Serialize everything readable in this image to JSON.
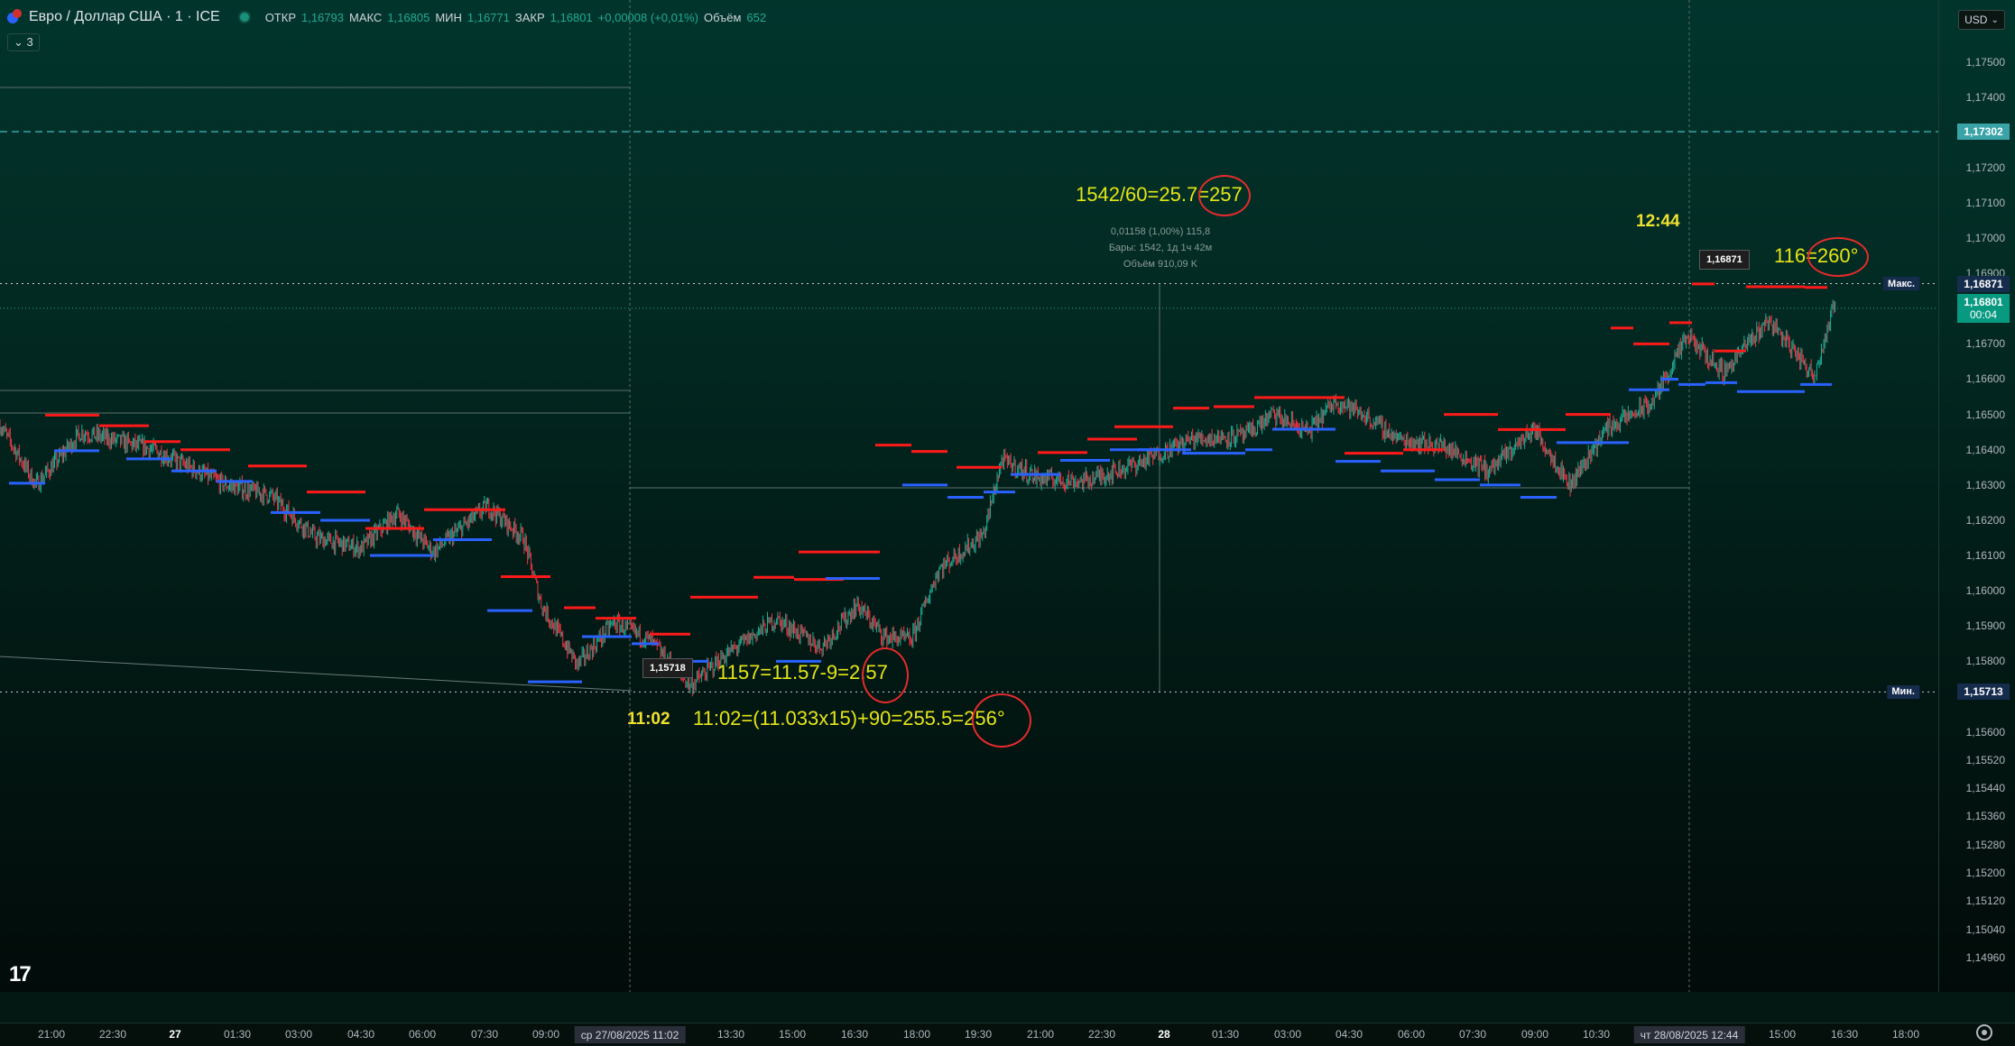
{
  "header": {
    "symbol_title": "Евро / Доллар США · 1 · ICE",
    "ohlc": [
      {
        "label": "ОТКР",
        "value": "1,16793"
      },
      {
        "label": "МАКС",
        "value": "1,16805"
      },
      {
        "label": "МИН",
        "value": "1,16771"
      },
      {
        "label": "ЗАКР",
        "value": "1,16801"
      }
    ],
    "change": "+0,00008 (+0,01%)",
    "volume_label": "Объём",
    "volume_value": "652",
    "indicators_count": "3",
    "currency_button": "USD"
  },
  "colors": {
    "up_candle": "#22ab94",
    "down_candle": "#f23645",
    "resistance_level": "#ff1a1a",
    "support_level": "#2962ff",
    "annotation_text": "#e5e517",
    "annotation_circle": "#e52b2b",
    "current_price": "#089981",
    "dashed_level": "#3aa3a8"
  },
  "price_axis": {
    "ticks": [
      "1,17500",
      "1,17400",
      "1,17200",
      "1,17100",
      "1,17000",
      "1,16900",
      "1,16700",
      "1,16600",
      "1,16500",
      "1,16400",
      "1,16300",
      "1,16200",
      "1,16100",
      "1,16000",
      "1,15900",
      "1,15800",
      "1,15600",
      "1,15520",
      "1,15440",
      "1,15360",
      "1,15280",
      "1,15200",
      "1,15120",
      "1,15040",
      "1,14960"
    ],
    "dashed_level_label": "1,17302",
    "max_tag": "Макс.",
    "max_value": "1,16871",
    "current_price": "1,16801",
    "countdown": "00:04",
    "min_tag": "Мин.",
    "min_value": "1,15713"
  },
  "time_axis": {
    "ticks": [
      {
        "label": "21:00",
        "bold": false
      },
      {
        "label": "22:30",
        "bold": false
      },
      {
        "label": "27",
        "bold": true
      },
      {
        "label": "01:30",
        "bold": false
      },
      {
        "label": "03:00",
        "bold": false
      },
      {
        "label": "04:30",
        "bold": false
      },
      {
        "label": "06:00",
        "bold": false
      },
      {
        "label": "07:30",
        "bold": false
      },
      {
        "label": "09:00",
        "bold": false
      },
      {
        "label": "13:30",
        "bold": false
      },
      {
        "label": "15:00",
        "bold": false
      },
      {
        "label": "16:30",
        "bold": false
      },
      {
        "label": "18:00",
        "bold": false
      },
      {
        "label": "19:30",
        "bold": false
      },
      {
        "label": "21:00",
        "bold": false
      },
      {
        "label": "22:30",
        "bold": false
      },
      {
        "label": "28",
        "bold": true
      },
      {
        "label": "01:30",
        "bold": false
      },
      {
        "label": "03:00",
        "bold": false
      },
      {
        "label": "04:30",
        "bold": false
      },
      {
        "label": "06:00",
        "bold": false
      },
      {
        "label": "07:30",
        "bold": false
      },
      {
        "label": "09:00",
        "bold": false
      },
      {
        "label": "10:30",
        "bold": false
      },
      {
        "label": "15:00",
        "bold": false
      },
      {
        "label": "16:30",
        "bold": false
      },
      {
        "label": "18:00",
        "bold": false
      }
    ],
    "flag_left": "ср 27/08/2025   11:02",
    "flag_right": "чт 28/08/2025   12:44"
  },
  "annotations": {
    "top_formula": "1542/60=25.7=257",
    "measure_line1": "0,01158 (1,00%) 115,8",
    "measure_line2": "Бары: 1542, 1д 1ч 42м",
    "measure_line3": "Объём 910,09 K",
    "time_high": "12:44",
    "high_angle": "116=260°",
    "high_price_flag": "1,16871",
    "low_price_flag": "1,15718",
    "low_formula": "1157=11.57-9=2.57",
    "time_low": "11:02",
    "time_formula": "11:02=(11.033x15)+90=255.5=256°"
  },
  "chart_data": {
    "type": "candlestick",
    "title": "Евро / Доллар США · 1 · ICE",
    "interval": "1",
    "ylim": [
      1.1491,
      1.1758
    ],
    "session_high": 1.16871,
    "session_low": 1.15713,
    "last_price": 1.16801,
    "dashed_level": 1.17302,
    "gridlines": false,
    "path_anchors": [
      [
        0,
        1.1647
      ],
      [
        40,
        1.163
      ],
      [
        90,
        1.1645
      ],
      [
        170,
        1.164
      ],
      [
        250,
        1.163
      ],
      [
        300,
        1.1627
      ],
      [
        350,
        1.1615
      ],
      [
        400,
        1.1612
      ],
      [
        440,
        1.1622
      ],
      [
        480,
        1.1611
      ],
      [
        540,
        1.1624
      ],
      [
        580,
        1.1615
      ],
      [
        600,
        1.1596
      ],
      [
        640,
        1.1579
      ],
      [
        680,
        1.1591
      ],
      [
        720,
        1.1586
      ],
      [
        765,
        1.1573
      ],
      [
        800,
        1.1581
      ],
      [
        860,
        1.1592
      ],
      [
        910,
        1.1584
      ],
      [
        950,
        1.1596
      ],
      [
        980,
        1.1587
      ],
      [
        1010,
        1.1586
      ],
      [
        1040,
        1.1606
      ],
      [
        1090,
        1.1616
      ],
      [
        1110,
        1.1637
      ],
      [
        1150,
        1.1632
      ],
      [
        1200,
        1.1631
      ],
      [
        1260,
        1.1636
      ],
      [
        1320,
        1.1643
      ],
      [
        1380,
        1.1644
      ],
      [
        1410,
        1.165
      ],
      [
        1450,
        1.1645
      ],
      [
        1480,
        1.1654
      ],
      [
        1510,
        1.165
      ],
      [
        1550,
        1.1643
      ],
      [
        1600,
        1.1641
      ],
      [
        1650,
        1.1634
      ],
      [
        1700,
        1.1646
      ],
      [
        1740,
        1.163
      ],
      [
        1780,
        1.1646
      ],
      [
        1830,
        1.1653
      ],
      [
        1870,
        1.1672
      ],
      [
        1910,
        1.1662
      ],
      [
        1960,
        1.1677
      ],
      [
        2010,
        1.1661
      ],
      [
        2040,
        1.1687
      ],
      [
        2080,
        1.166
      ],
      [
        2110,
        1.1678
      ],
      [
        2150,
        1.1668
      ],
      [
        2180,
        1.166
      ],
      [
        2210,
        1.1679
      ]
    ],
    "levels": [
      {
        "kind": "resistance",
        "x1": 50,
        "x2": 110,
        "price": 1.16498
      },
      {
        "kind": "resistance",
        "x1": 110,
        "x2": 165,
        "price": 1.16468
      },
      {
        "kind": "support",
        "x1": 10,
        "x2": 50,
        "price": 1.16305
      },
      {
        "kind": "support",
        "x1": 60,
        "x2": 110,
        "price": 1.16397
      },
      {
        "kind": "resistance",
        "x1": 160,
        "x2": 200,
        "price": 1.16423
      },
      {
        "kind": "support",
        "x1": 140,
        "x2": 190,
        "price": 1.16374
      },
      {
        "kind": "resistance",
        "x1": 200,
        "x2": 255,
        "price": 1.164
      },
      {
        "kind": "support",
        "x1": 190,
        "x2": 240,
        "price": 1.1634
      },
      {
        "kind": "resistance",
        "x1": 275,
        "x2": 340,
        "price": 1.16354
      },
      {
        "kind": "support",
        "x1": 240,
        "x2": 280,
        "price": 1.1631
      },
      {
        "kind": "resistance",
        "x1": 340,
        "x2": 405,
        "price": 1.1628
      },
      {
        "kind": "support",
        "x1": 300,
        "x2": 355,
        "price": 1.16222
      },
      {
        "kind": "resistance",
        "x1": 405,
        "x2": 470,
        "price": 1.16177
      },
      {
        "kind": "support",
        "x1": 355,
        "x2": 410,
        "price": 1.162
      },
      {
        "kind": "resistance",
        "x1": 470,
        "x2": 560,
        "price": 1.1623
      },
      {
        "kind": "support",
        "x1": 410,
        "x2": 480,
        "price": 1.161
      },
      {
        "kind": "resistance",
        "x1": 555,
        "x2": 610,
        "price": 1.1604
      },
      {
        "kind": "support",
        "x1": 480,
        "x2": 545,
        "price": 1.16145
      },
      {
        "kind": "resistance",
        "x1": 625,
        "x2": 660,
        "price": 1.15952
      },
      {
        "kind": "support",
        "x1": 540,
        "x2": 590,
        "price": 1.15944
      },
      {
        "kind": "resistance",
        "x1": 660,
        "x2": 705,
        "price": 1.15922
      },
      {
        "kind": "support",
        "x1": 585,
        "x2": 645,
        "price": 1.15742
      },
      {
        "kind": "resistance",
        "x1": 720,
        "x2": 765,
        "price": 1.15877
      },
      {
        "kind": "support",
        "x1": 645,
        "x2": 700,
        "price": 1.1587
      },
      {
        "kind": "resistance",
        "x1": 765,
        "x2": 840,
        "price": 1.15982
      },
      {
        "kind": "support",
        "x1": 700,
        "x2": 730,
        "price": 1.1585
      },
      {
        "kind": "resistance",
        "x1": 835,
        "x2": 880,
        "price": 1.16038
      },
      {
        "kind": "support",
        "x1": 725,
        "x2": 785,
        "price": 1.158
      },
      {
        "kind": "resistance",
        "x1": 880,
        "x2": 935,
        "price": 1.16032
      },
      {
        "kind": "support",
        "x1": 860,
        "x2": 910,
        "price": 1.158
      },
      {
        "kind": "resistance",
        "x1": 885,
        "x2": 975,
        "price": 1.1611
      },
      {
        "kind": "support",
        "x1": 915,
        "x2": 975,
        "price": 1.16035
      },
      {
        "kind": "resistance",
        "x1": 970,
        "x2": 1010,
        "price": 1.16413
      },
      {
        "kind": "support",
        "x1": 1000,
        "x2": 1050,
        "price": 1.163
      },
      {
        "kind": "resistance",
        "x1": 1010,
        "x2": 1050,
        "price": 1.16395
      },
      {
        "kind": "support",
        "x1": 1050,
        "x2": 1090,
        "price": 1.16265
      },
      {
        "kind": "resistance",
        "x1": 1060,
        "x2": 1110,
        "price": 1.1635
      },
      {
        "kind": "support",
        "x1": 1090,
        "x2": 1125,
        "price": 1.1628
      },
      {
        "kind": "resistance",
        "x1": 1150,
        "x2": 1205,
        "price": 1.16392
      },
      {
        "kind": "support",
        "x1": 1120,
        "x2": 1175,
        "price": 1.1633
      },
      {
        "kind": "resistance",
        "x1": 1205,
        "x2": 1260,
        "price": 1.1643
      },
      {
        "kind": "support",
        "x1": 1175,
        "x2": 1230,
        "price": 1.1637
      },
      {
        "kind": "resistance",
        "x1": 1235,
        "x2": 1300,
        "price": 1.16465
      },
      {
        "kind": "support",
        "x1": 1230,
        "x2": 1285,
        "price": 1.164
      },
      {
        "kind": "resistance",
        "x1": 1300,
        "x2": 1340,
        "price": 1.16518
      },
      {
        "kind": "support",
        "x1": 1260,
        "x2": 1320,
        "price": 1.164
      },
      {
        "kind": "resistance",
        "x1": 1345,
        "x2": 1390,
        "price": 1.16522
      },
      {
        "kind": "support",
        "x1": 1310,
        "x2": 1380,
        "price": 1.1639
      },
      {
        "kind": "resistance",
        "x1": 1390,
        "x2": 1425,
        "price": 1.16548
      },
      {
        "kind": "support",
        "x1": 1380,
        "x2": 1410,
        "price": 1.164
      },
      {
        "kind": "resistance",
        "x1": 1425,
        "x2": 1490,
        "price": 1.16548
      },
      {
        "kind": "support",
        "x1": 1410,
        "x2": 1480,
        "price": 1.16458
      },
      {
        "kind": "resistance",
        "x1": 1490,
        "x2": 1555,
        "price": 1.1639
      },
      {
        "kind": "support",
        "x1": 1480,
        "x2": 1530,
        "price": 1.16367
      },
      {
        "kind": "resistance",
        "x1": 1555,
        "x2": 1600,
        "price": 1.164
      },
      {
        "kind": "support",
        "x1": 1530,
        "x2": 1590,
        "price": 1.1634
      },
      {
        "kind": "resistance",
        "x1": 1600,
        "x2": 1660,
        "price": 1.165
      },
      {
        "kind": "support",
        "x1": 1590,
        "x2": 1640,
        "price": 1.16315
      },
      {
        "kind": "resistance",
        "x1": 1660,
        "x2": 1735,
        "price": 1.16457
      },
      {
        "kind": "support",
        "x1": 1640,
        "x2": 1685,
        "price": 1.163
      },
      {
        "kind": "resistance",
        "x1": 1735,
        "x2": 1785,
        "price": 1.165
      },
      {
        "kind": "support",
        "x1": 1685,
        "x2": 1725,
        "price": 1.16265
      },
      {
        "kind": "resistance",
        "x1": 1785,
        "x2": 1810,
        "price": 1.16745
      },
      {
        "kind": "support",
        "x1": 1725,
        "x2": 1805,
        "price": 1.1642
      },
      {
        "kind": "resistance",
        "x1": 1810,
        "x2": 1850,
        "price": 1.167
      },
      {
        "kind": "support",
        "x1": 1805,
        "x2": 1850,
        "price": 1.1657
      },
      {
        "kind": "resistance",
        "x1": 1850,
        "x2": 1875,
        "price": 1.1676
      },
      {
        "kind": "support",
        "x1": 1840,
        "x2": 1860,
        "price": 1.166
      },
      {
        "kind": "resistance",
        "x1": 1875,
        "x2": 1900,
        "price": 1.1687
      },
      {
        "kind": "support",
        "x1": 1860,
        "x2": 1890,
        "price": 1.16585
      },
      {
        "kind": "resistance",
        "x1": 1900,
        "x2": 1935,
        "price": 1.1668
      },
      {
        "kind": "support",
        "x1": 1890,
        "x2": 1925,
        "price": 1.1659
      },
      {
        "kind": "resistance",
        "x1": 1935,
        "x2": 2000,
        "price": 1.16862
      },
      {
        "kind": "support",
        "x1": 1925,
        "x2": 2000,
        "price": 1.16565
      },
      {
        "kind": "resistance",
        "x1": 2000,
        "x2": 2025,
        "price": 1.1686
      },
      {
        "kind": "support",
        "x1": 1995,
        "x2": 2030,
        "price": 1.16585
      }
    ]
  }
}
